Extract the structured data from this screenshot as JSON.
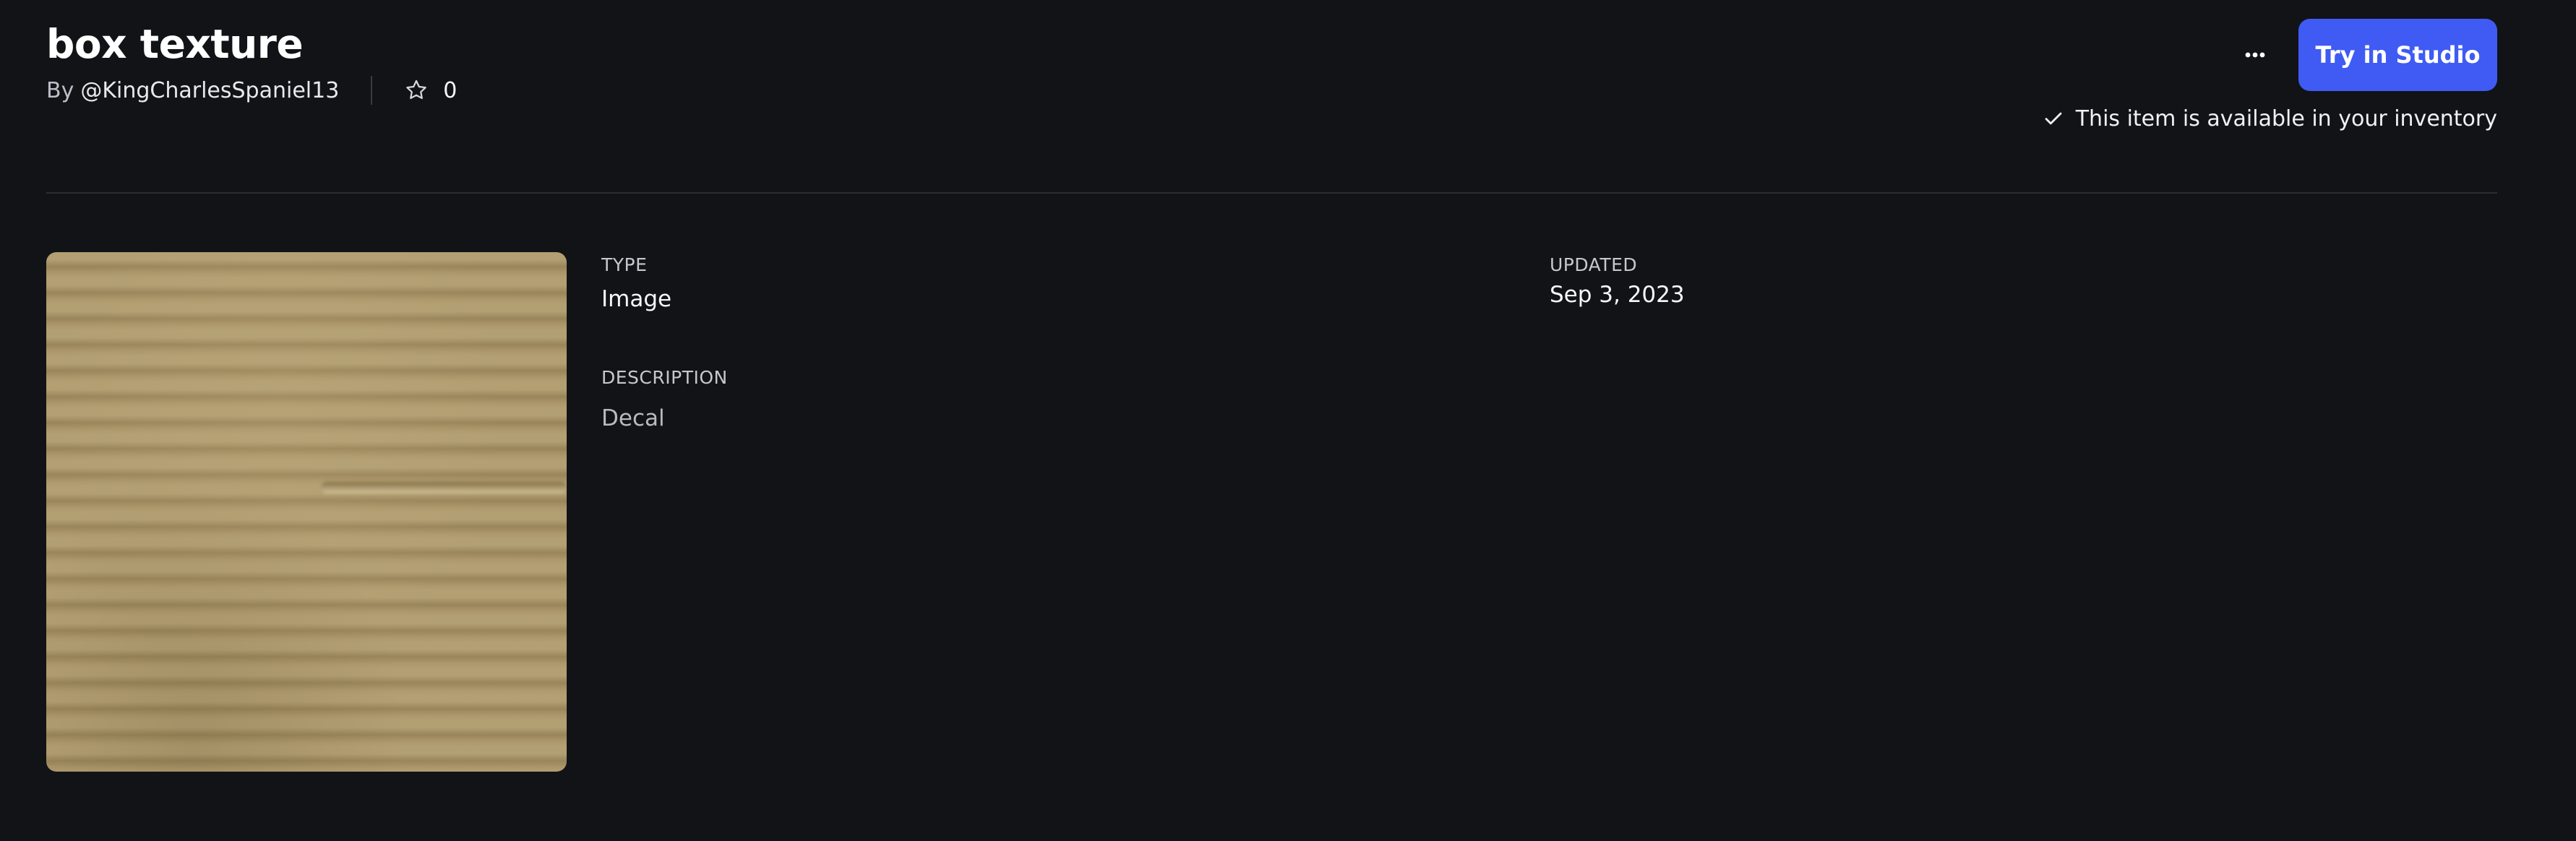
{
  "asset": {
    "title": "box texture",
    "by_prefix": "By",
    "creator": "@KingCharlesSpaniel13",
    "favorites_count": "0"
  },
  "actions": {
    "more_icon": "ellipsis-icon",
    "try_label": "Try in Studio",
    "inventory_note": "This item is available in your inventory",
    "accent_color": "#3f5bf4"
  },
  "details": {
    "type_label": "TYPE",
    "type_value": "Image",
    "description_label": "DESCRIPTION",
    "description_value": "Decal",
    "updated_label": "UPDATED",
    "updated_value": "Sep 3, 2023"
  },
  "icons": {
    "favorite": "star-outline-icon",
    "check": "check-icon"
  }
}
